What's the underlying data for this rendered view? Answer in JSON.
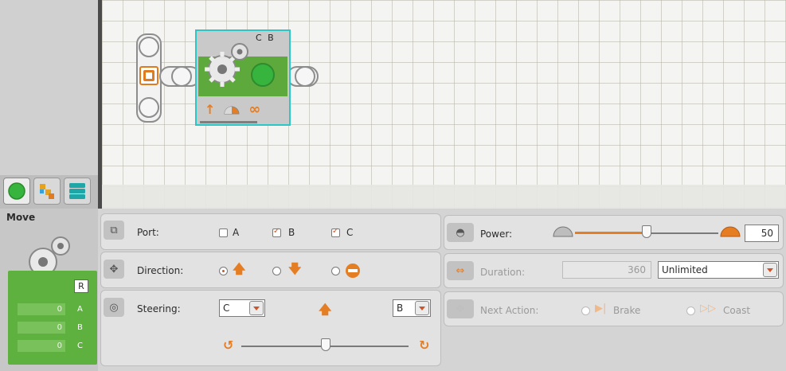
{
  "canvas": {
    "block": {
      "ports_label": "C B"
    }
  },
  "palette": {
    "tabs": [
      {
        "name": "common-palette-tab",
        "icon": "green-circle-icon"
      },
      {
        "name": "complete-palette-tab",
        "icon": "blocks-icon"
      },
      {
        "name": "custom-palette-tab",
        "icon": "stack-icon"
      }
    ]
  },
  "summary": {
    "title": "Move",
    "reset_label": "R",
    "rows": [
      {
        "value": "0",
        "port": "A"
      },
      {
        "value": "0",
        "port": "B"
      },
      {
        "value": "0",
        "port": "C"
      }
    ]
  },
  "config": {
    "port": {
      "label": "Port:",
      "options": [
        {
          "label": "A",
          "checked": false
        },
        {
          "label": "B",
          "checked": true
        },
        {
          "label": "C",
          "checked": true
        }
      ]
    },
    "direction": {
      "label": "Direction:",
      "options": [
        {
          "icon": "forward-arrow-icon",
          "selected": true
        },
        {
          "icon": "backward-arrow-icon",
          "selected": false
        },
        {
          "icon": "stop-icon",
          "selected": false
        }
      ]
    },
    "steering": {
      "label": "Steering:",
      "left_port": "C",
      "right_port": "B",
      "slider_value": 0
    },
    "power": {
      "label": "Power:",
      "value": "50",
      "slider_fraction": 0.5
    },
    "duration": {
      "label": "Duration:",
      "value": "360",
      "unit": "Unlimited"
    },
    "next_action": {
      "label": "Next Action:",
      "options": [
        {
          "label": "Brake"
        },
        {
          "label": "Coast"
        }
      ]
    }
  },
  "colors": {
    "accent_orange": "#e57d23",
    "block_green": "#5ea93b",
    "selection_cyan": "#2cc6c6"
  }
}
